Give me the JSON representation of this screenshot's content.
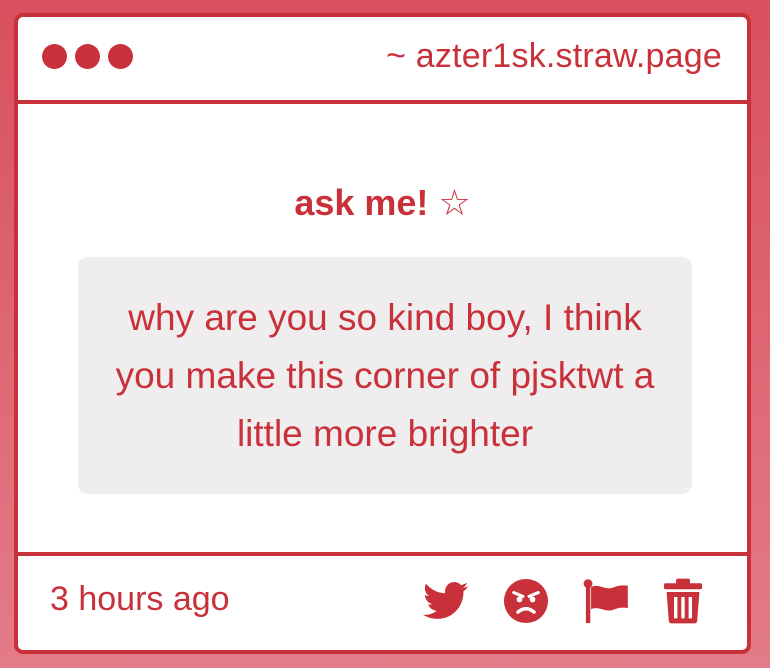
{
  "window": {
    "url": "~ azter1sk.straw.page"
  },
  "main": {
    "heading": "ask me! ☆",
    "question": "why are you so kind boy, I think you make this corner of pjsktwt a little more brighter"
  },
  "footer": {
    "timestamp": "3 hours ago",
    "actions": [
      {
        "icon": "twitter-icon"
      },
      {
        "icon": "angry-face-icon"
      },
      {
        "icon": "flag-icon"
      },
      {
        "icon": "trash-icon"
      }
    ]
  },
  "colors": {
    "accent": "#c8303a",
    "background_top": "#d9505e",
    "background_bottom": "#e37c88",
    "question_box": "#efedee",
    "card": "#ffffff"
  }
}
